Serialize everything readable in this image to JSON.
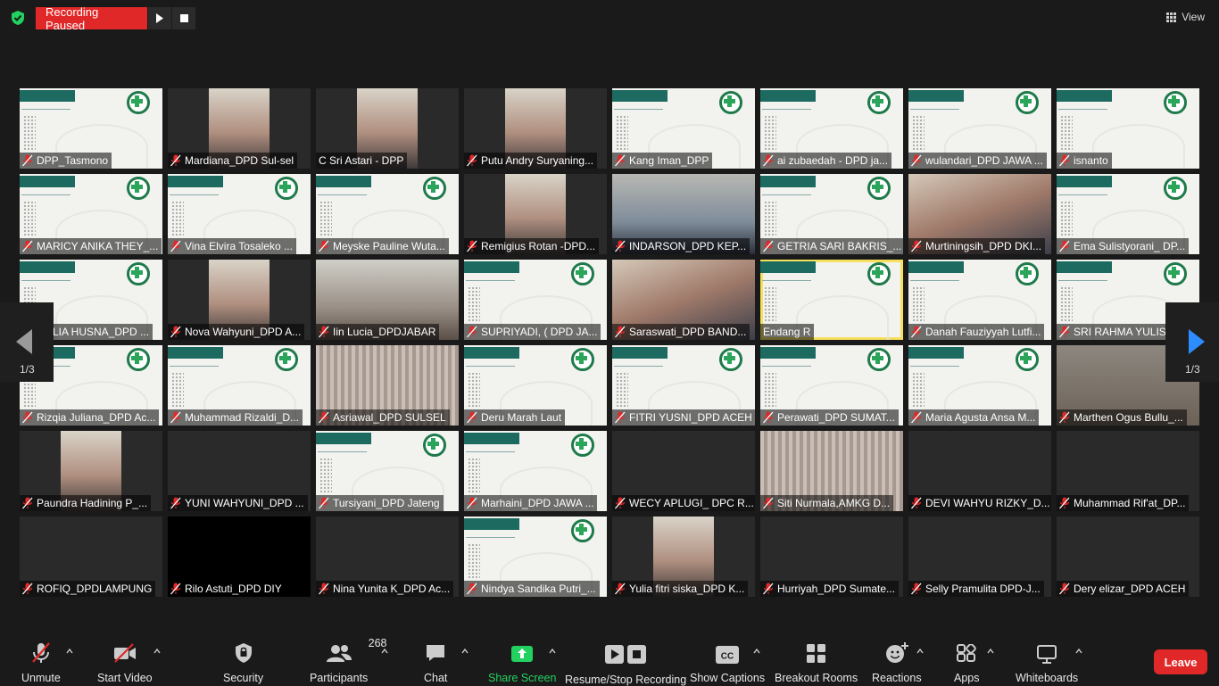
{
  "recording": {
    "label": "Recording Paused"
  },
  "view": {
    "label": "View"
  },
  "pager": {
    "left_label": "1/3",
    "right_label": "1/3"
  },
  "participants": [
    {
      "name": "DPP_Tasmono",
      "style": "slide"
    },
    {
      "name": "Mardiana_DPD Sul-sel",
      "style": "portrait"
    },
    {
      "name": "C Sri Astari -  DPP",
      "style": "portrait",
      "no_mic": true
    },
    {
      "name": "Putu Andry Suryaning...",
      "style": "portrait"
    },
    {
      "name": "Kang Iman_DPP",
      "style": "slide"
    },
    {
      "name": "ai zubaedah - DPD ja...",
      "style": "slide"
    },
    {
      "name": "wulandari_DPD JAWA ...",
      "style": "slide"
    },
    {
      "name": "isnanto",
      "style": "slide"
    },
    {
      "name": "MARICY ANIKA THEY_...",
      "style": "slide"
    },
    {
      "name": "Vina Elvira Tosaleko ...",
      "style": "slide"
    },
    {
      "name": "Meyske Pauline Wuta...",
      "style": "slide"
    },
    {
      "name": "Remigius Rotan -DPD...",
      "style": "portrait"
    },
    {
      "name": "INDARSON_DPD KEP...",
      "style": "cam3"
    },
    {
      "name": "GETRIA SARI BAKRIS_...",
      "style": "slide"
    },
    {
      "name": "Murtiningsih_DPD DKI...",
      "style": "cam2"
    },
    {
      "name": "Ema Sulistyorani_ DP...",
      "style": "slide"
    },
    {
      "name": "MALIA HUSNA_DPD ...",
      "style": "slide"
    },
    {
      "name": "Nova Wahyuni_DPD A...",
      "style": "portrait"
    },
    {
      "name": "Iin Lucia_DPDJABAR",
      "style": "cam"
    },
    {
      "name": "SUPRIYADI, ( DPD JA...",
      "style": "slide"
    },
    {
      "name": "Saraswati_DPD BAND...",
      "style": "cam2"
    },
    {
      "name": "Endang R",
      "style": "slide",
      "active": true,
      "no_mic": true
    },
    {
      "name": "Danah Fauziyyah Lutfi...",
      "style": "slide"
    },
    {
      "name": "SRI RAHMA YULIS",
      "style": "slide"
    },
    {
      "name": "Rizqia Juliana_DPD Ac...",
      "style": "slide"
    },
    {
      "name": "Muhammad Rizaldi_D...",
      "style": "slide"
    },
    {
      "name": "Asriawal_DPD SULSEL",
      "style": "curtain"
    },
    {
      "name": "Deru Marah Laut",
      "style": "slide"
    },
    {
      "name": "FITRI YUSNI_DPD ACEH",
      "style": "slide"
    },
    {
      "name": "Perawati_DPD SUMAT...",
      "style": "slide"
    },
    {
      "name": "Maria Agusta Ansa M...",
      "style": "slide"
    },
    {
      "name": "Marthen Ogus Bullu_...",
      "style": "wall"
    },
    {
      "name": "Paundra Hadining P_...",
      "style": "portrait"
    },
    {
      "name": "YUNI WAHYUNI_DPD ...",
      "style": "empty"
    },
    {
      "name": "Tursiyani_DPD Jateng",
      "style": "slide"
    },
    {
      "name": "Marhaini_DPD JAWA ...",
      "style": "slide"
    },
    {
      "name": "WECY APLUGI_ DPC R...",
      "style": "empty"
    },
    {
      "name": "Siti Nurmala,AMKG D...",
      "style": "curtain"
    },
    {
      "name": "DEVI WAHYU RIZKY_D...",
      "style": "empty"
    },
    {
      "name": "Muhammad Rif'at_DP...",
      "style": "empty"
    },
    {
      "name": "ROFIQ_DPDLAMPUNG",
      "style": "empty"
    },
    {
      "name": "Rilo Astuti_DPD DIY",
      "style": "black"
    },
    {
      "name": "Nina Yunita K_DPD Ac...",
      "style": "empty"
    },
    {
      "name": "Nindya Sandika Putri_...",
      "style": "slide"
    },
    {
      "name": "Yulia fitri siska_DPD K...",
      "style": "portrait"
    },
    {
      "name": "Hurriyah_DPD Sumate...",
      "style": "empty"
    },
    {
      "name": "Selly Pramulita DPD-J...",
      "style": "empty"
    },
    {
      "name": "Dery elizar_DPD ACEH",
      "style": "empty"
    }
  ],
  "toolbar": {
    "unmute": "Unmute",
    "start_video": "Start Video",
    "security": "Security",
    "participants": "Participants",
    "participants_count": "268",
    "chat": "Chat",
    "share_screen": "Share Screen",
    "resume_stop": "Resume/Stop Recording",
    "show_captions": "Show Captions",
    "breakout_rooms": "Breakout Rooms",
    "reactions": "Reactions",
    "apps": "Apps",
    "whiteboards": "Whiteboards",
    "leave": "Leave"
  },
  "colors": {
    "accent_green": "#23d160",
    "record_red": "#e02828",
    "active_speaker": "#f6e05e"
  }
}
